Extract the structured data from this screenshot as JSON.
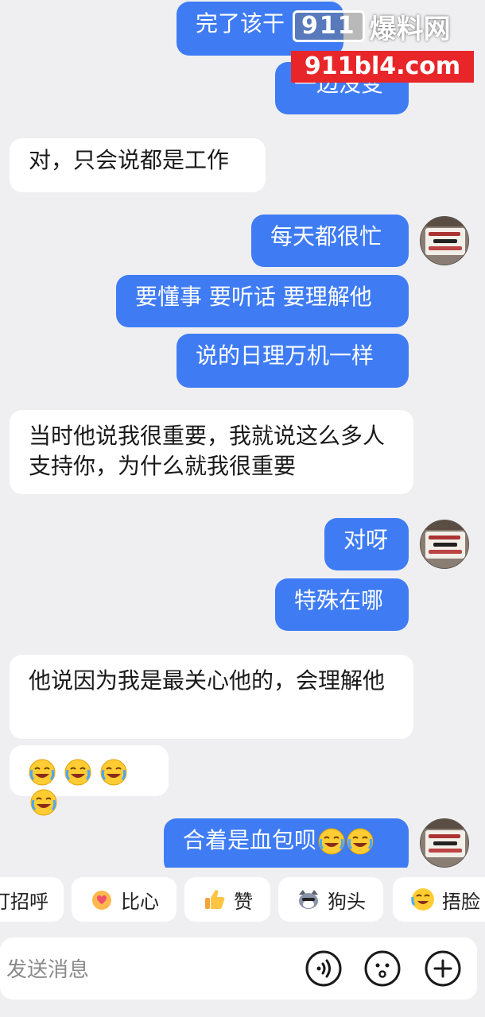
{
  "messages": [
    {
      "side": "out",
      "text": "完了该干"
    },
    {
      "side": "out",
      "text": "一边没变"
    },
    {
      "side": "in",
      "text": "对，只会说都是工作"
    },
    {
      "side": "out",
      "text": "每天都很忙"
    },
    {
      "side": "out",
      "text": "要懂事 要听话 要理解他"
    },
    {
      "side": "out",
      "text": "说的日理万机一样"
    },
    {
      "side": "in",
      "text": "当时他说我很重要，我就说这么多人支持你，为什么就我很重要"
    },
    {
      "side": "out",
      "text": "对呀"
    },
    {
      "side": "out",
      "text": "特殊在哪"
    },
    {
      "side": "in",
      "text": "他说因为我是最关心他的，会理解他"
    },
    {
      "side": "in",
      "emoji": [
        "laughing-crying-emoji",
        "laughing-crying-emoji",
        "laughing-crying-emoji",
        "laughing-crying-emoji"
      ]
    },
    {
      "side": "out",
      "text": "合着是血包呗",
      "emoji": [
        "laughing-crying-emoji",
        "laughing-crying-emoji"
      ]
    }
  ],
  "watermark": {
    "brand_num": "911",
    "brand_cn": "爆料网",
    "url": "911bl4.com"
  },
  "quick_replies": [
    {
      "label": "打招呼",
      "icon": "wave-icon"
    },
    {
      "label": "比心",
      "icon": "heart-hands-icon"
    },
    {
      "label": "赞",
      "icon": "thumbs-up-icon"
    },
    {
      "label": "狗头",
      "icon": "doge-icon"
    },
    {
      "label": "捂脸",
      "icon": "facepalm-icon"
    }
  ],
  "input": {
    "placeholder": "发送消息"
  },
  "input_buttons": [
    "voice-icon",
    "emoji-icon",
    "plus-icon"
  ],
  "colors": {
    "outgoing": "#3f7cf4",
    "incoming": "#ffffff",
    "background": "#efeff1",
    "watermark_red": "#e8262a"
  }
}
